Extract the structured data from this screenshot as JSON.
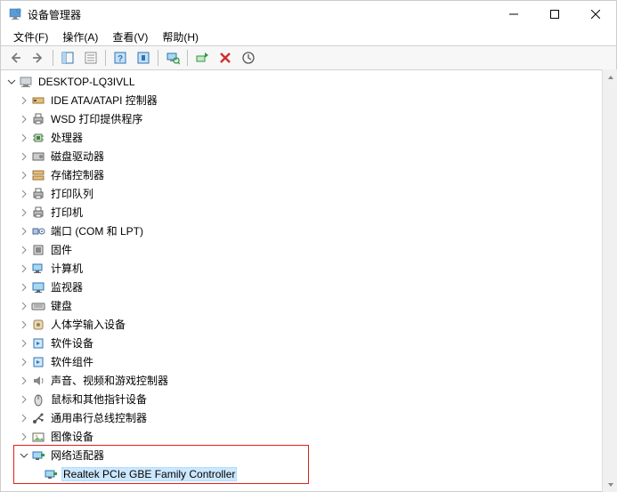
{
  "window": {
    "title": "设备管理器"
  },
  "menu": {
    "file": "文件(F)",
    "action": "操作(A)",
    "view": "查看(V)",
    "help": "帮助(H)"
  },
  "tree": {
    "root": "DESKTOP-LQ3IVLL",
    "categories": [
      {
        "label": "IDE ATA/ATAPI 控制器",
        "icon": "ide"
      },
      {
        "label": "WSD 打印提供程序",
        "icon": "printer"
      },
      {
        "label": "处理器",
        "icon": "cpu"
      },
      {
        "label": "磁盘驱动器",
        "icon": "disk"
      },
      {
        "label": "存储控制器",
        "icon": "storage"
      },
      {
        "label": "打印队列",
        "icon": "printq"
      },
      {
        "label": "打印机",
        "icon": "printer2"
      },
      {
        "label": "端口 (COM 和 LPT)",
        "icon": "port"
      },
      {
        "label": "固件",
        "icon": "firmware"
      },
      {
        "label": "计算机",
        "icon": "computer"
      },
      {
        "label": "监视器",
        "icon": "monitor"
      },
      {
        "label": "键盘",
        "icon": "keyboard"
      },
      {
        "label": "人体学输入设备",
        "icon": "hid"
      },
      {
        "label": "软件设备",
        "icon": "software"
      },
      {
        "label": "软件组件",
        "icon": "software2"
      },
      {
        "label": "声音、视频和游戏控制器",
        "icon": "audio"
      },
      {
        "label": "鼠标和其他指针设备",
        "icon": "mouse"
      },
      {
        "label": "通用串行总线控制器",
        "icon": "usb"
      },
      {
        "label": "图像设备",
        "icon": "image"
      }
    ],
    "expanded_category": "网络适配器",
    "selected_device": "Realtek PCIe GBE Family Controller"
  }
}
